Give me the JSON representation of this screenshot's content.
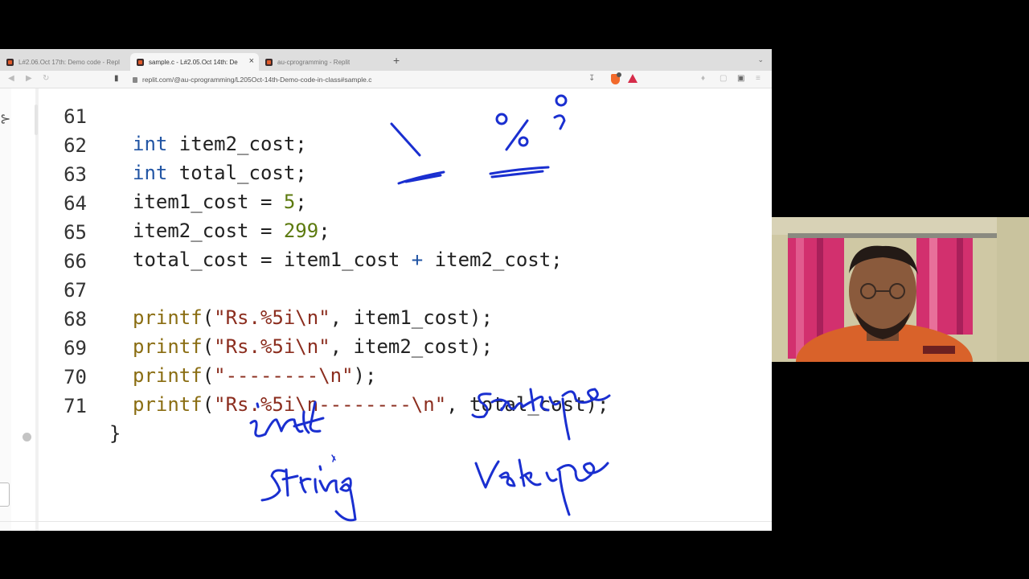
{
  "browser": {
    "tabs": [
      {
        "label": "L#2.06.Oct 17th: Demo code - Repl",
        "active": false
      },
      {
        "label": "sample.c - L#2.05.Oct 14th: De",
        "active": true
      },
      {
        "label": "au-cprogramming - Replit",
        "active": false
      }
    ],
    "new_tab_label": "+",
    "tab_close_label": "×",
    "url": "replit.com/@au-cprogramming/L205Oct-14th-Demo-code-in-class#sample.c",
    "brave_badge_count": "8"
  },
  "editor": {
    "lines": [
      {
        "num": "61",
        "text": "int item2_cost;"
      },
      {
        "num": "62",
        "text": "int total_cost;"
      },
      {
        "num": "63",
        "text": "item1_cost = 5;"
      },
      {
        "num": "64",
        "text": "item2_cost = 299;"
      },
      {
        "num": "65",
        "text": "total_cost = item1_cost + item2_cost;"
      },
      {
        "num": "66",
        "text": ""
      },
      {
        "num": "67",
        "text": "printf(\"Rs.%5i\\n\", item1_cost);"
      },
      {
        "num": "68",
        "text": "printf(\"Rs.%5i\\n\", item2_cost);"
      },
      {
        "num": "69",
        "text": "printf(\"--------\\n\");"
      },
      {
        "num": "70",
        "text": "printf(\"Rs.%5i\\n--------\\n\", total_cost);"
      },
      {
        "num": "71",
        "text": "}"
      }
    ]
  },
  "annotations": {
    "handwritten_words": [
      "int",
      "sankye",
      "string",
      "vakya"
    ],
    "ink_color": "#1a2fd0"
  },
  "webcam": {
    "description_colors": {
      "wall": "#cfc8a4",
      "curtain": "#d2306e",
      "shirt": "#d9622a"
    }
  },
  "colors": {
    "keyword": "#2255a4",
    "number": "#5c7a0e",
    "function": "#8a6d12",
    "string": "#8b2d1e"
  }
}
